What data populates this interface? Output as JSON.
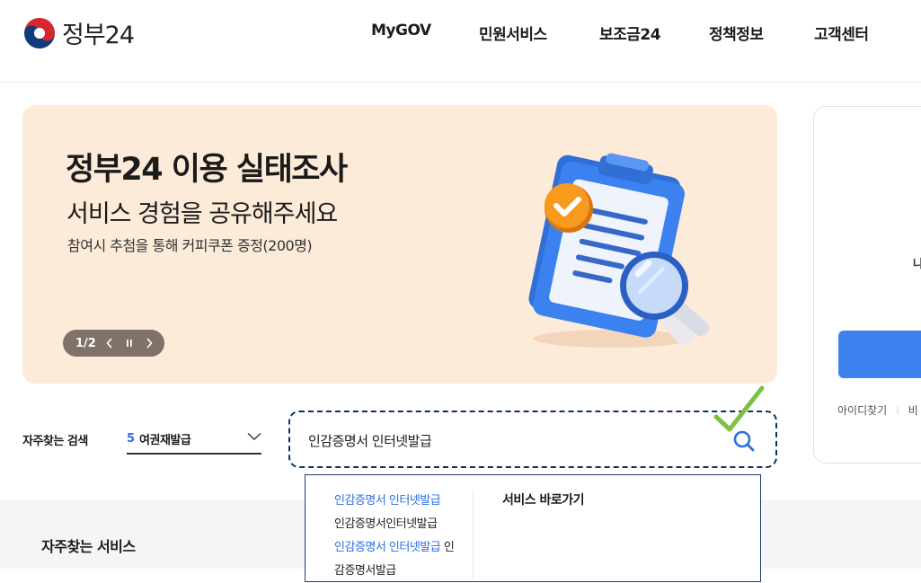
{
  "header": {
    "logo_text": "정부24",
    "nav": [
      "MyGOV",
      "민원서비스",
      "보조금24",
      "정책정보",
      "고객센터"
    ]
  },
  "banner": {
    "title": "정부24 이용 실태조사",
    "subtitle": "서비스 경험을 공유해주세요",
    "description": "참여시 추첨을 통해 커피쿠폰 증정(200명)",
    "slide_counter": "1/2",
    "colors": {
      "background": "#fdebd9",
      "control": "#7e7269"
    }
  },
  "login_card": {
    "partial_text": "나",
    "links": [
      "아이디찾기",
      "비"
    ],
    "button_color": "#3e82f0"
  },
  "search": {
    "frequent_label": "자주찾는 검색",
    "frequent_rank": "5",
    "frequent_term": "여권재발급",
    "query": "인감증명서 인터넷발급",
    "accent_color": "#2b6fe0"
  },
  "autocomplete": {
    "items": [
      {
        "text": "인감증명서 인터넷발급",
        "tail": "",
        "highlight": true
      },
      {
        "text": "인감증명서인터넷발급",
        "tail": "",
        "highlight": false
      },
      {
        "text": "인감증명서 인터넷발급",
        "tail": " 인",
        "highlight": true
      },
      {
        "text": "감증명서발급",
        "tail": "",
        "highlight": false
      }
    ],
    "shortcut_title": "서비스 바로가기"
  },
  "lower": {
    "section_title": "자주찾는 서비스"
  }
}
